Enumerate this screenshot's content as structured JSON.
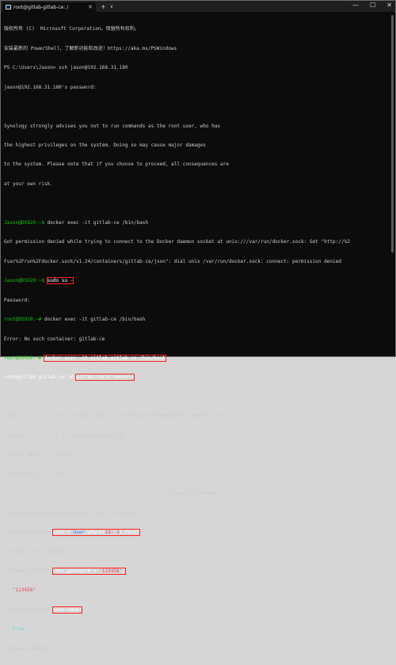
{
  "window": {
    "tab_title": "root@gitlab-gitlab-ce: /",
    "tab_close": "✕",
    "new_tab": "+",
    "dropdown": "∨",
    "minimize": "—",
    "maximize": "☐",
    "close": "✕"
  },
  "terminal": {
    "l1": "版权所有 (C)  Microsoft Corporation。保留所有权利。",
    "l2": "安装最新的 PowerShell，了解新功能和改进！https://aka.ms/PSWindows",
    "l3": "PS C:\\Users\\Jason> ssh jason@192.168.31.180",
    "l4": "jason@192.168.31.180's password:",
    "l5": "",
    "l6": "Synology strongly advises you not to run commands as the root user, who has",
    "l7": "the highest privileges on the system. Doing so may cause major damages",
    "l8": "to the system. Please note that if you choose to proceed, all consequences are",
    "l9": "at your own risk.",
    "l10": "",
    "l11_prompt": "Jason@DS920:~$",
    "l11_cmd": " docker exec -it gitlab-ce /bin/bash",
    "l12": "Got permission denied while trying to connect to the Docker daemon socket at unix:///var/run/docker.sock: Get \"http://%2",
    "l13": "Fvar%2Frun%2Fdocker.sock/v1.24/containers/gitlab-ce/json\": dial unix /var/run/docker.sock: connect: permission denied",
    "l14_prompt": "Jason@DS920:~$",
    "l14_cmd": "sudo su -",
    "l15": "Password:",
    "l16_prompt": "root@DS920:~#",
    "l16_cmd": " docker exec -it gitlab-ce /bin/bash",
    "l17": "Error: No such container: gitlab-ce",
    "l18_prompt": "root@DS920:~#",
    "l18_cmd": "docker exec -it gitlab-gitlab-ce /bin/bash",
    "l19_prompt": "root@gitlab-gitlab-ce:/#",
    "l19_cmd": "gitlab-rails console",
    "sep": "--------------------------------------------------------------------------------",
    "ruby_k": " Ruby:",
    "ruby_v": "ruby 2.7.5p203 (2021-11-24 revision f69aeb8314) [x86_64-linux]",
    "gitlab_k": " GitLab:",
    "gitlab_v": "14.7.2 (89599212ee6) FOSS",
    "shell_k": " GitLab Shell:",
    "shell_v": "13.22.2",
    "pg_k": " PostgreSQL:",
    "pg_v": "12.7",
    "sep2": "--------------------------------------------------------[ booted in 44.64s ]",
    "loading": "Loading production environment (Rails 6.1.4.4)",
    "irb1_prompt": "irb(main):001:0>",
    "irb1_a": "user = ",
    "irb1_b": "User",
    "irb1_c": ".where(",
    "irb1_d": "id: 1",
    "irb1_e": ").first",
    "res1": "=> #<User id:1 @root>",
    "irb2_prompt": "irb(main):002:0>",
    "irb2_a": "user.password = ",
    "irb2_b": "'123456'",
    "irb2_c": ";",
    "res2_arrow": "=> ",
    "res2_val": "\"123456\"",
    "irb3_prompt": "irb(main):003:0>",
    "irb3_cmd": "user.save!",
    "res3_arrow": "=> ",
    "res3_val": "true",
    "irb4_prompt": "irb(main):004:0>"
  }
}
